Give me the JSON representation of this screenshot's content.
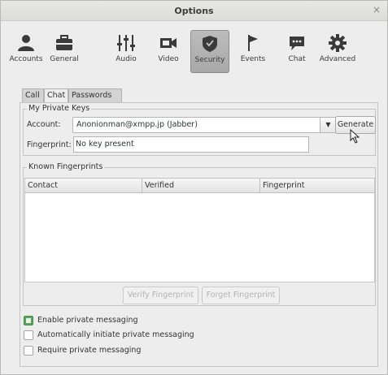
{
  "window": {
    "title": "Options",
    "close_glyph": "×"
  },
  "toolbar": {
    "items": [
      {
        "label": "Accounts",
        "icon": "accounts-icon",
        "active": false
      },
      {
        "label": "General",
        "icon": "general-icon",
        "active": false
      },
      {
        "label": "Audio",
        "icon": "audio-icon",
        "active": false
      },
      {
        "label": "Video",
        "icon": "video-icon",
        "active": false
      },
      {
        "label": "Security",
        "icon": "security-icon",
        "active": true
      },
      {
        "label": "Events",
        "icon": "events-icon",
        "active": false
      },
      {
        "label": "Chat",
        "icon": "chat-icon",
        "active": false
      },
      {
        "label": "Advanced",
        "icon": "advanced-icon",
        "active": false
      }
    ]
  },
  "subtabs": [
    {
      "label": "Call",
      "active": false
    },
    {
      "label": "Chat",
      "active": true
    },
    {
      "label": "Passwords",
      "active": false
    }
  ],
  "private_keys": {
    "legend": "My Private Keys",
    "account_label": "Account:",
    "account_value": "Anonionman@xmpp.jp (Jabber)",
    "generate_label": "Generate",
    "fingerprint_label": "Fingerprint:",
    "fingerprint_value": "No key present"
  },
  "known_fingerprints": {
    "legend": "Known Fingerprints",
    "columns": [
      "Contact",
      "Verified",
      "Fingerprint"
    ],
    "verify_label": "Verify Fingerprint",
    "forget_label": "Forget Fingerprint"
  },
  "options": [
    {
      "label": "Enable private messaging",
      "checked": true
    },
    {
      "label": "Automatically initiate private messaging",
      "checked": false
    },
    {
      "label": "Require private messaging",
      "checked": false
    }
  ],
  "colors": {
    "active_tab": "#b0b0b0",
    "checkbox_checked": "#5da35d"
  }
}
